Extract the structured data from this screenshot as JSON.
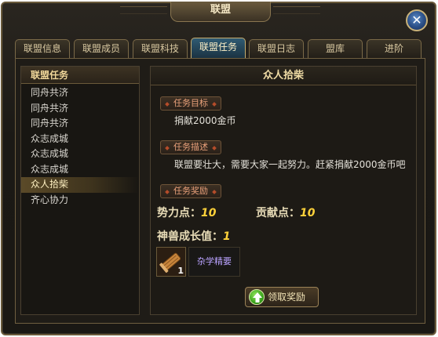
{
  "window": {
    "title": "联盟",
    "close_glyph": "✕"
  },
  "tabs": [
    {
      "label": "联盟信息"
    },
    {
      "label": "联盟成员"
    },
    {
      "label": "联盟科技"
    },
    {
      "label": "联盟任务",
      "active": true
    },
    {
      "label": "联盟日志"
    },
    {
      "label": "盟库"
    },
    {
      "label": "进阶"
    }
  ],
  "left_panel": {
    "header": "联盟任务",
    "items": [
      {
        "label": "同舟共济"
      },
      {
        "label": "同舟共济"
      },
      {
        "label": "同舟共济"
      },
      {
        "label": "众志成城"
      },
      {
        "label": "众志成城"
      },
      {
        "label": "众志成城"
      },
      {
        "label": "众人拾柴",
        "selected": true
      },
      {
        "label": "齐心协力"
      }
    ]
  },
  "detail": {
    "title": "众人拾柴",
    "goal_label": "任务目标",
    "goal_text": "捐献2000金币",
    "desc_label": "任务描述",
    "desc_text": "联盟要壮大，需要大家一起努力。赶紧捐献2000金币吧",
    "reward_label": "任务奖励",
    "power_label": "势力点：",
    "power_value": "10",
    "contrib_label": "贡献点：",
    "contrib_value": "10",
    "beast_label": "神兽成长值：",
    "beast_value": "1",
    "item_count": "1",
    "item_name": "杂学精要",
    "claim_label": "领取奖励"
  },
  "icons": {
    "close": "close-icon",
    "item": "scroll-item-icon",
    "claim": "up-arrow-icon"
  },
  "colors": {
    "accent_gold": "#ffd23a",
    "label_red": "#e8a07a",
    "item_purple": "#b9a2ff"
  }
}
